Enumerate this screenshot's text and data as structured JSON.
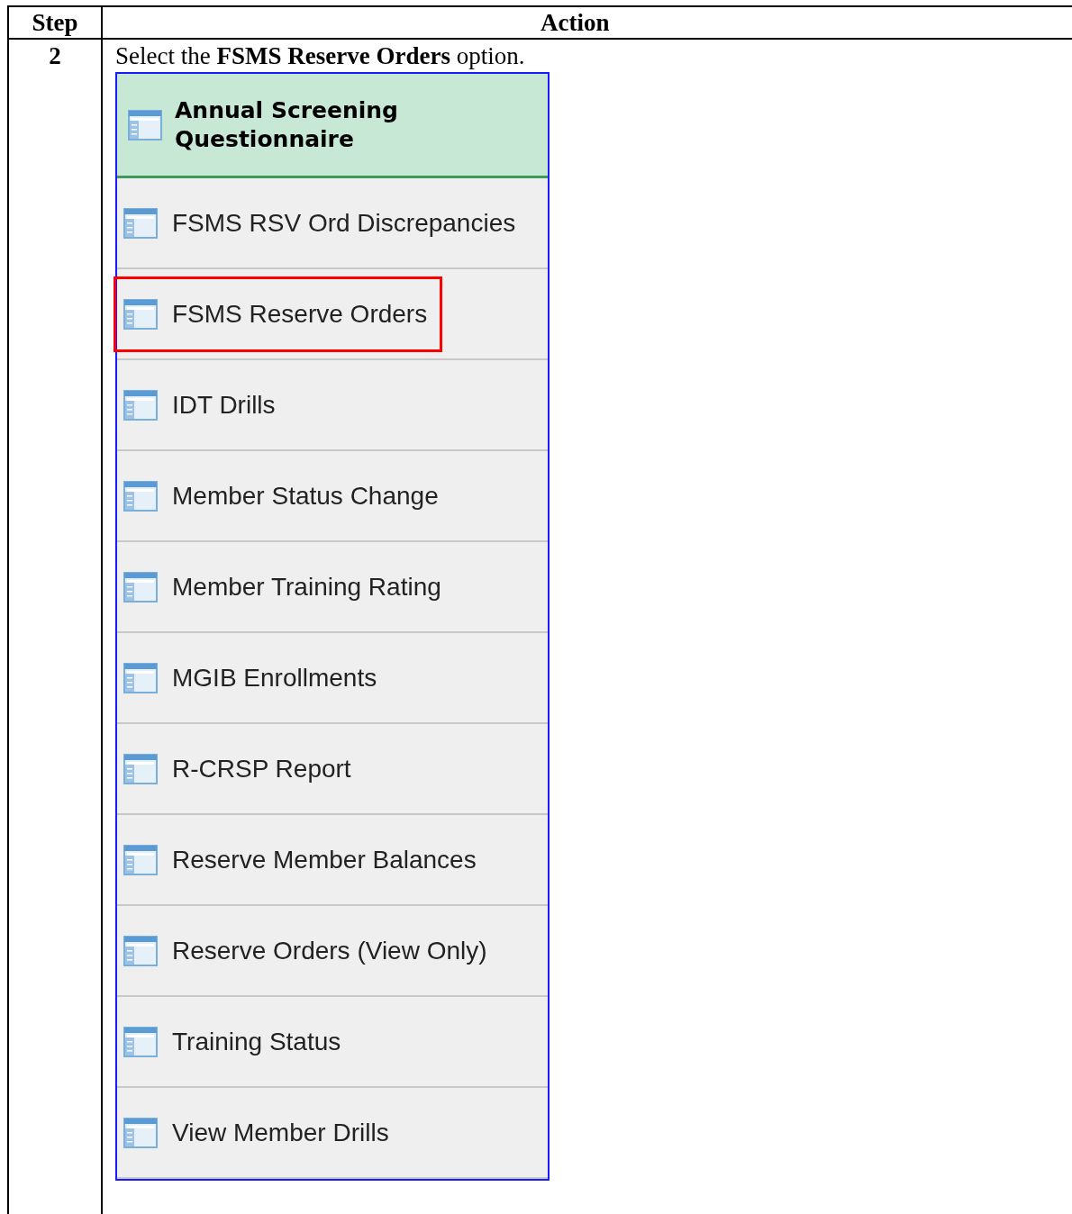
{
  "table": {
    "columns": [
      "Step",
      "Action"
    ],
    "rows": [
      {
        "step": "2",
        "instruction": "Select the **FSMS Reserve Orders** option.",
        "screenshot": {
          "header": "Annual Screening Questionnaire",
          "items": [
            {
              "label": "FSMS RSV Ord Discrepancies",
              "highlighted": false
            },
            {
              "label": "FSMS Reserve Orders",
              "highlighted": true
            },
            {
              "label": "IDT Drills",
              "highlighted": false
            },
            {
              "label": "Member Status Change",
              "highlighted": false
            },
            {
              "label": "Member Training Rating",
              "highlighted": false
            },
            {
              "label": "MGIB Enrollments",
              "highlighted": false
            },
            {
              "label": "R-CRSP Report",
              "highlighted": false
            },
            {
              "label": "Reserve Member Balances",
              "highlighted": false
            },
            {
              "label": "Reserve Orders (View Only)",
              "highlighted": false
            },
            {
              "label": "Training Status",
              "highlighted": false
            },
            {
              "label": "View Member Drills",
              "highlighted": false
            }
          ]
        }
      }
    ]
  }
}
